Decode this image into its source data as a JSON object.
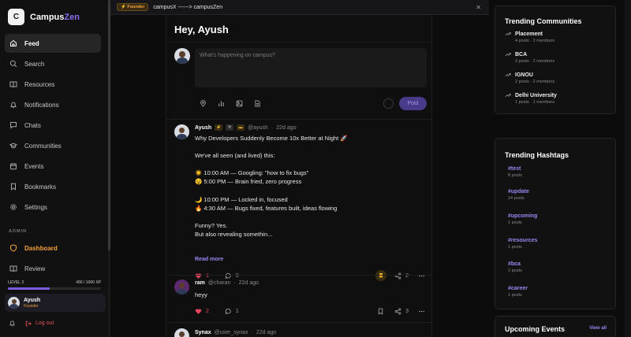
{
  "brand": {
    "logo_letter": "C",
    "name_part1": "Campus",
    "name_part2": "Zen",
    "accent_color": "#8b6cf0"
  },
  "sidebar": {
    "items": [
      {
        "label": "Feed",
        "icon": "home-icon",
        "active": true
      },
      {
        "label": "Search",
        "icon": "search-icon"
      },
      {
        "label": "Resources",
        "icon": "book-icon"
      },
      {
        "label": "Notifications",
        "icon": "bell-icon"
      },
      {
        "label": "Chats",
        "icon": "chat-icon"
      },
      {
        "label": "Communities",
        "icon": "graduation-cap-icon"
      },
      {
        "label": "Events",
        "icon": "calendar-icon"
      },
      {
        "label": "Bookmarks",
        "icon": "bookmark-icon"
      },
      {
        "label": "Settings",
        "icon": "gear-icon"
      }
    ],
    "admin_label": "ADMIN",
    "admin_items": [
      {
        "label": "Dashboard",
        "icon": "shield-icon"
      },
      {
        "label": "Review",
        "icon": "book-icon"
      }
    ],
    "level": {
      "label": "LEVEL 3",
      "xp": "450 / 1000 XP",
      "progress": 0.45
    },
    "user": {
      "name": "Ayush",
      "role": "Founder"
    },
    "logout_label": "Log out"
  },
  "banner": {
    "badge": "⚡ Founder",
    "text": "campusX ------> campusZen",
    "close": "✕"
  },
  "feed": {
    "title": "Hey, Ayush",
    "composer_placeholder": "What's happening on campus?",
    "post_button": "Post",
    "posts": [
      {
        "author": "Ayush",
        "handle": "@ayush",
        "time": "22d ago",
        "body": "Why Developers Suddenly Become 10x Better at Night 🚀\n\nWe've all seen (and lived) this:\n\n☀️ 10:00 AM — Googling: \"how to fix bugs\"\n😵 5:00 PM — Brain fried, zero progress\n\n🌙 10:00 PM — Locked in, focused\n🔥 4:30 AM — Bugs fixed, features built, ideas flowing\n\nFunny? Yes.\nBut also revealing somethin...",
        "read_more": "Read more",
        "likes": "1",
        "comments": "0",
        "shares": "2"
      },
      {
        "author": "ram",
        "handle": "@charan",
        "time": "22d ago",
        "body": "heyy",
        "likes": "2",
        "comments": "1",
        "shares": "3"
      },
      {
        "author": "Synax",
        "handle": "@user_synax",
        "time": "22d ago"
      }
    ]
  },
  "trending_communities": {
    "title": "Trending Communities",
    "items": [
      {
        "name": "Placement",
        "meta": "4 posts · 2 members"
      },
      {
        "name": "BCA",
        "meta": "3 posts · 2 members"
      },
      {
        "name": "IGNOU",
        "meta": "2 posts · 2 members"
      },
      {
        "name": "Delhi University",
        "meta": "1 posts · 1 members"
      }
    ]
  },
  "trending_hashtags": {
    "title": "Trending Hashtags",
    "items": [
      {
        "tag": "#test",
        "meta": "8 posts"
      },
      {
        "tag": "#update",
        "meta": "14 posts"
      },
      {
        "tag": "#upcoming",
        "meta": "1 posts"
      },
      {
        "tag": "#resources",
        "meta": "1 posts"
      },
      {
        "tag": "#bca",
        "meta": "2 posts"
      },
      {
        "tag": "#career",
        "meta": "1 posts"
      }
    ]
  },
  "upcoming_events": {
    "title": "Upcoming Events",
    "view_all": "View all"
  }
}
